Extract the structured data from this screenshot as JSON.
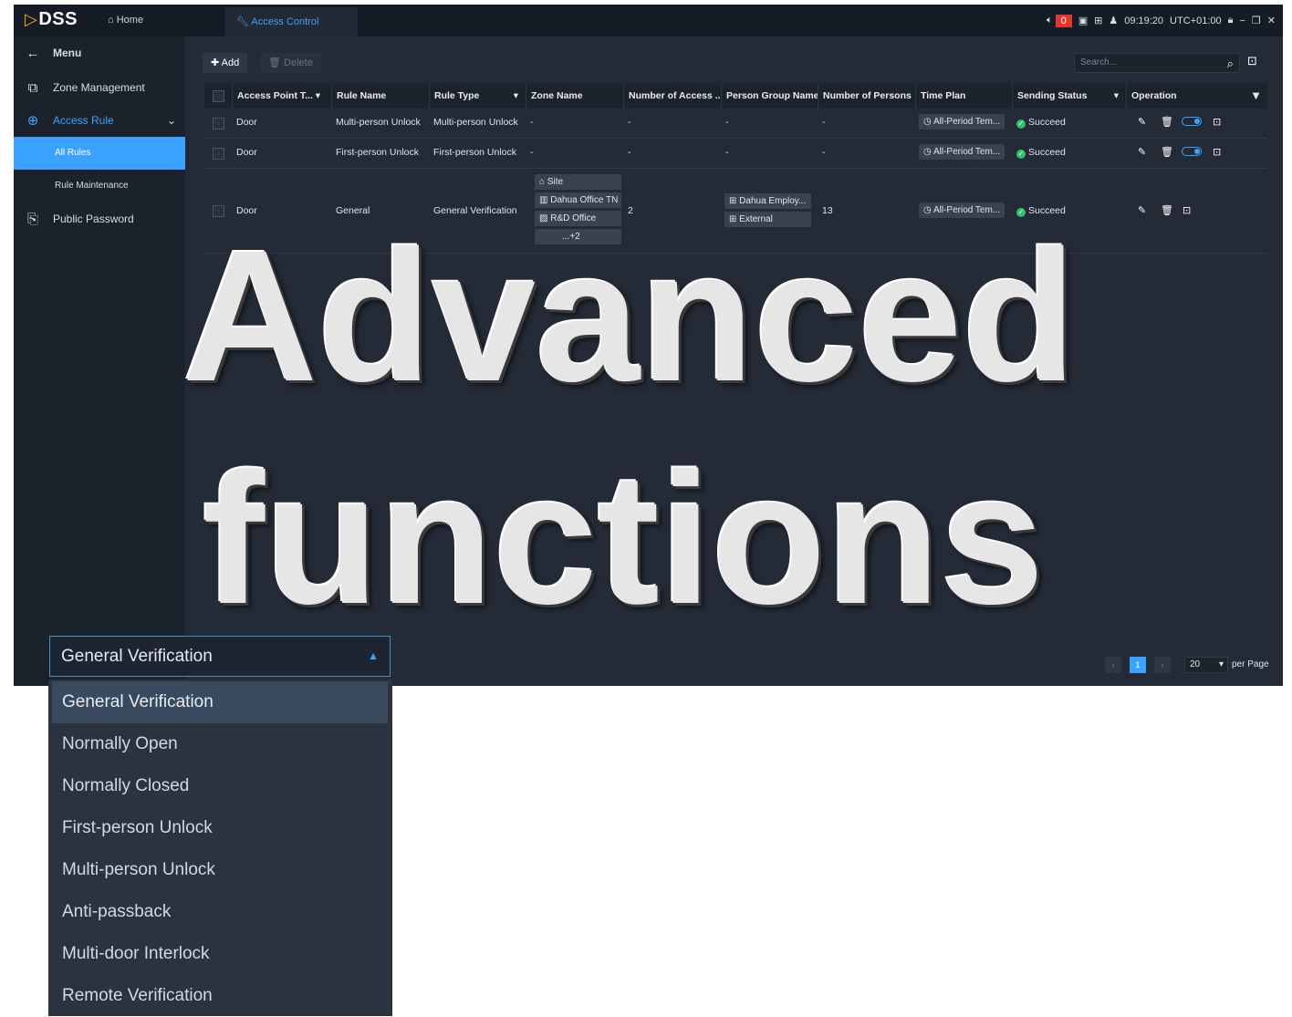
{
  "app": {
    "logo": "DSS",
    "home_tab": "Home",
    "active_tab": "Access Control",
    "alarm_count": "0",
    "time": "09:19:20",
    "timezone": "UTC+01:00"
  },
  "sidebar": {
    "title": "Menu",
    "items": [
      {
        "label": "Zone Management",
        "icon": "zone-icon"
      },
      {
        "label": "Access Rule",
        "icon": "access-rule-icon"
      },
      {
        "label": "All Rules"
      },
      {
        "label": "Rule Maintenance"
      },
      {
        "label": "Public Password",
        "icon": "password-icon"
      }
    ]
  },
  "toolbar": {
    "add_label": "Add",
    "delete_label": "Delete",
    "search_placeholder": "Search..."
  },
  "table": {
    "columns": [
      "Access Point T...",
      "Rule Name",
      "Rule Type",
      "Zone Name",
      "Number of Access ...",
      "Person Group Name",
      "Number of Persons",
      "Time Plan",
      "Sending Status",
      "Operation"
    ],
    "rows": [
      {
        "access_point": "Door",
        "rule_name": "Multi-person Unlock",
        "rule_type": "Multi-person Unlock",
        "zone": "-",
        "num_access": "-",
        "person_group": "-",
        "num_persons": "-",
        "time_plan": "All-Period Tem...",
        "status": "Succeed"
      },
      {
        "access_point": "Door",
        "rule_name": "First-person Unlock",
        "rule_type": "First-person Unlock",
        "zone": "-",
        "num_access": "-",
        "person_group": "-",
        "num_persons": "-",
        "time_plan": "All-Period Tem...",
        "status": "Succeed"
      },
      {
        "access_point": "Door",
        "rule_name": "General",
        "rule_type": "General Verification",
        "zones": [
          "Site",
          "Dahua Office TN",
          "R&D Office",
          "...+2"
        ],
        "num_access": "2",
        "person_groups": [
          "Dahua Employ...",
          "External"
        ],
        "num_persons": "13",
        "time_plan": "All-Period Tem...",
        "status": "Succeed"
      }
    ]
  },
  "pager": {
    "current_page": "1",
    "page_size": "20",
    "per_page_label": "per Page"
  },
  "overlay": {
    "line1": "Advanced",
    "line2": "functions"
  },
  "dropdown": {
    "selected": "General Verification",
    "options": [
      "General Verification",
      "Normally Open",
      "Normally Closed",
      "First-person Unlock",
      "Multi-person Unlock",
      "Anti-passback",
      "Multi-door Interlock",
      "Remote Verification"
    ]
  },
  "colors": {
    "accent": "#3ba3ff",
    "success": "#2ec36b",
    "alarm": "#e4362e",
    "background": "#232a35"
  }
}
